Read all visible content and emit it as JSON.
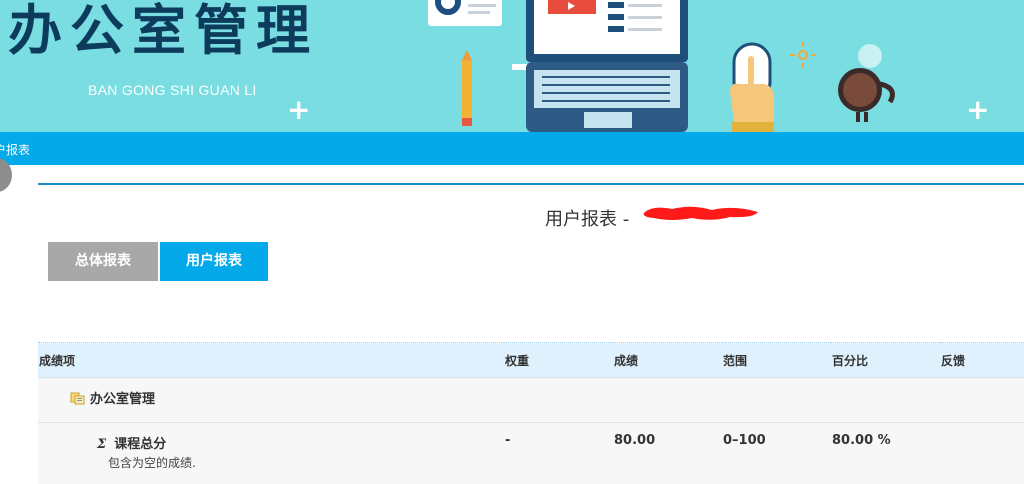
{
  "banner": {
    "title": "办公室管理",
    "subtitle": "BAN GONG SHI GUAN LI"
  },
  "breadcrumb": {
    "text": "户报表"
  },
  "report": {
    "title": "用户报表 -"
  },
  "tabs": [
    {
      "label": "总体报表",
      "active": false
    },
    {
      "label": "用户报表",
      "active": true
    }
  ],
  "table": {
    "headers": [
      "成绩项",
      "权重",
      "成绩",
      "范围",
      "百分比",
      "反馈"
    ],
    "category": {
      "name": "办公室管理"
    },
    "item": {
      "name": "课程总分",
      "note": "包含为空的成绩.",
      "weight": "-",
      "grade": "80.00",
      "range": "0–100",
      "percentage": "80.00 %",
      "feedback": ""
    }
  },
  "colors": {
    "banner_bg": "#79dde2",
    "banner_title": "#0d3b5c",
    "accent_blue": "#03a9e8",
    "tab_inactive": "#a8a8a8",
    "table_header_bg": "#dff1fc"
  },
  "icons": [
    "folder-icon",
    "sigma-icon",
    "pencil-icon",
    "laptop-icon",
    "hand-mouse-icon",
    "coffee-cup-icon",
    "plus-icon"
  ]
}
